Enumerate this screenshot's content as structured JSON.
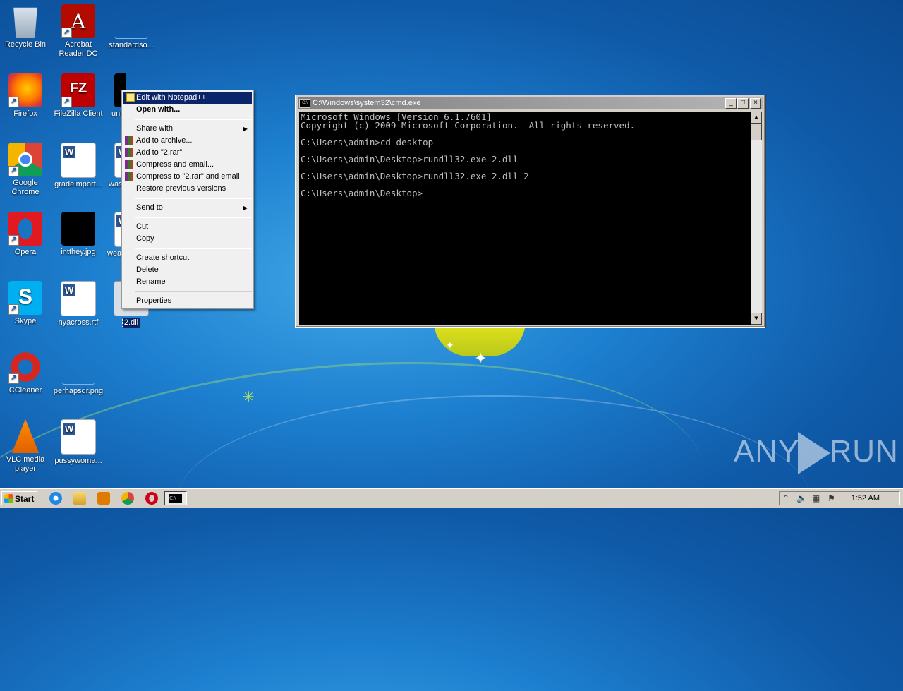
{
  "desktop": {
    "icons": [
      {
        "label": "Recycle Bin",
        "icon": "recycle-bin-icon"
      },
      {
        "label": "Acrobat Reader DC",
        "icon": "acrobat-icon"
      },
      {
        "label": "standardso...",
        "icon": "blank-file-icon"
      },
      {
        "label": "Firefox",
        "icon": "firefox-icon"
      },
      {
        "label": "FileZilla Client",
        "icon": "filezilla-icon"
      },
      {
        "label": "unt...",
        "icon": "black-image-icon"
      },
      {
        "label": "Google Chrome",
        "icon": "chrome-icon"
      },
      {
        "label": "gradeimport...",
        "icon": "word-doc-icon"
      },
      {
        "label": "was...",
        "icon": "word-doc-icon"
      },
      {
        "label": "Opera",
        "icon": "opera-icon"
      },
      {
        "label": "intthey.jpg",
        "icon": "black-image-icon"
      },
      {
        "label": "wea...",
        "icon": "word-doc-icon"
      },
      {
        "label": "Skype",
        "icon": "skype-icon"
      },
      {
        "label": "nyacross.rtf",
        "icon": "word-doc-icon"
      },
      {
        "label": "2.dll",
        "icon": "dll-file-icon"
      },
      {
        "label": "CCleaner",
        "icon": "ccleaner-icon"
      },
      {
        "label": "perhapsdr.png",
        "icon": "blank-image-icon"
      },
      {
        "label": "VLC media player",
        "icon": "vlc-icon"
      },
      {
        "label": "pussywoma...",
        "icon": "word-doc-icon"
      }
    ]
  },
  "context_menu": {
    "items": [
      {
        "label": "Edit with Notepad++",
        "icon": "notepadpp-icon"
      },
      {
        "label": "Open with..."
      },
      {
        "label": "Share with"
      },
      {
        "label": "Add to archive...",
        "icon": "winrar-icon"
      },
      {
        "label": "Add to \"2.rar\"",
        "icon": "winrar-icon"
      },
      {
        "label": "Compress and email...",
        "icon": "winrar-icon"
      },
      {
        "label": "Compress to \"2.rar\" and email",
        "icon": "winrar-icon"
      },
      {
        "label": "Restore previous versions"
      },
      {
        "label": "Send to"
      },
      {
        "label": "Cut"
      },
      {
        "label": "Copy"
      },
      {
        "label": "Create shortcut"
      },
      {
        "label": "Delete"
      },
      {
        "label": "Rename"
      },
      {
        "label": "Properties"
      }
    ]
  },
  "cmd_window": {
    "title": "C:\\Windows\\system32\\cmd.exe",
    "title_icon": "C:\\",
    "buttons": {
      "minimize": "_",
      "maximize": "□",
      "close": "×"
    },
    "lines": [
      "Microsoft Windows [Version 6.1.7601]",
      "Copyright (c) 2009 Microsoft Corporation.  All rights reserved.",
      "",
      "C:\\Users\\admin>cd desktop",
      "",
      "C:\\Users\\admin\\Desktop>rundll32.exe 2.dll",
      "",
      "C:\\Users\\admin\\Desktop>rundll32.exe 2.dll 2",
      "",
      "C:\\Users\\admin\\Desktop>"
    ]
  },
  "taskbar": {
    "start_label": "Start",
    "pinned": [
      "internet-explorer-icon",
      "explorer-icon",
      "media-player-icon",
      "chrome-icon",
      "opera-icon",
      "cmd-icon"
    ],
    "clock": "1:52 AM"
  },
  "watermark": {
    "left": "ANY",
    "right": "RUN"
  }
}
